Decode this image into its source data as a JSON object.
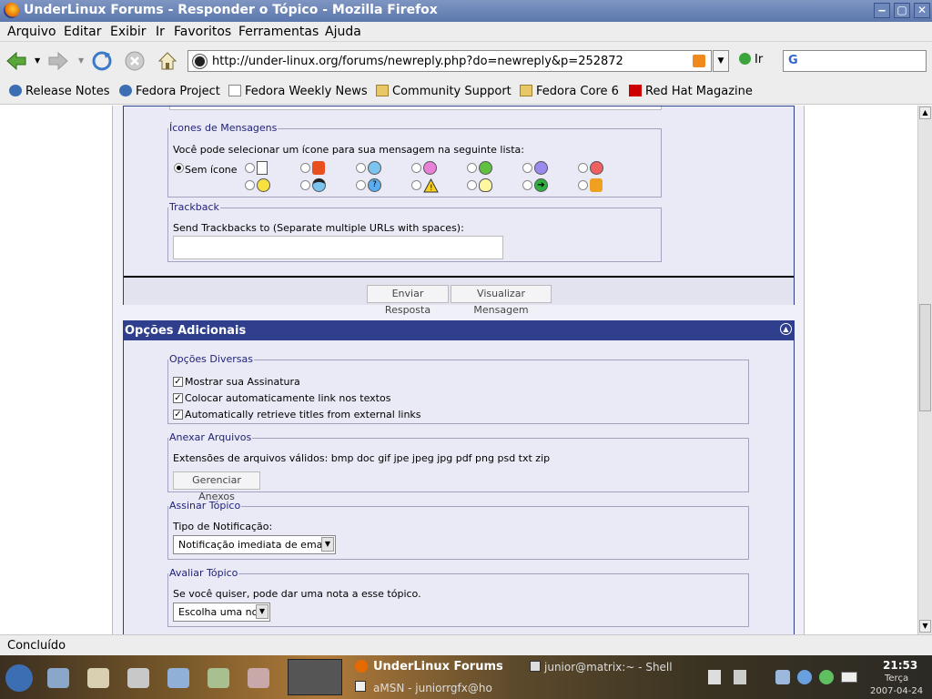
{
  "window": {
    "title": "UnderLinux Forums - Responder o Tópico - Mozilla Firefox",
    "btn_min": "‒",
    "btn_max": "▢",
    "btn_close": "✕"
  },
  "menu": [
    "Arquivo",
    "Editar",
    "Exibir",
    "Ir",
    "Favoritos",
    "Ferramentas",
    "Ajuda"
  ],
  "nav": {
    "url": "http://under-linux.org/forums/newreply.php?do=newreply&p=252872",
    "go_label": "Ir",
    "search_text": "G"
  },
  "bookmarks": [
    {
      "label": "Release Notes",
      "icon": "fedora-icon"
    },
    {
      "label": "Fedora Project",
      "icon": "fedora-icon"
    },
    {
      "label": "Fedora Weekly News",
      "icon": "page-icon"
    },
    {
      "label": "Community Support",
      "icon": "folder-icon"
    },
    {
      "label": "Fedora Core 6",
      "icon": "folder-icon"
    },
    {
      "label": "Red Hat Magazine",
      "icon": "redhat-icon"
    }
  ],
  "icons_section": {
    "legend": "Ícones de Mensagens",
    "intro": "Você pode selecionar um ícone para sua mensagem na seguinte lista:",
    "none_label": "Sem ícone",
    "row1": [
      "post-icon",
      "thumbs-down-icon",
      "wink-icon",
      "smile-pink-icon",
      "grin-icon",
      "sad-icon",
      "angry-icon"
    ],
    "row2": [
      "smile-icon",
      "cool-icon",
      "question-icon",
      "warning-icon",
      "idea-icon",
      "arrow-icon",
      "thumbs-up-icon"
    ]
  },
  "trackback": {
    "legend": "Trackback",
    "label": "Send Trackbacks to (Separate multiple URLs with spaces):"
  },
  "buttons": {
    "submit": "Enviar Resposta",
    "preview": "Visualizar Mensagem"
  },
  "additional": {
    "title": "Opções Adicionais",
    "misc": {
      "legend": "Opções Diversas",
      "options": [
        "Mostrar sua Assinatura",
        "Colocar automaticamente link nos textos",
        "Automatically retrieve titles from external links"
      ]
    },
    "attach": {
      "legend": "Anexar Arquivos",
      "text": "Extensões de arquivos válidos: bmp doc gif jpe jpeg jpg pdf png psd txt zip",
      "button": "Gerenciar Anexos"
    },
    "subscribe": {
      "legend": "Assinar Tópico",
      "label": "Tipo de Notificação:",
      "value": "Notificação imediata de email"
    },
    "rate": {
      "legend": "Avaliar Tópico",
      "label": "Se você quiser, pode dar uma nota a esse tópico.",
      "value": "Escolha uma nota"
    }
  },
  "status": "Concluído",
  "taskbar": {
    "window1": "UnderLinux Forums",
    "window2": "junior@matrix:~ - Shell",
    "window3": "aMSN - juniorrgfx@ho",
    "clock": "21:53",
    "day": "Terça",
    "date": "2007-04-24"
  }
}
